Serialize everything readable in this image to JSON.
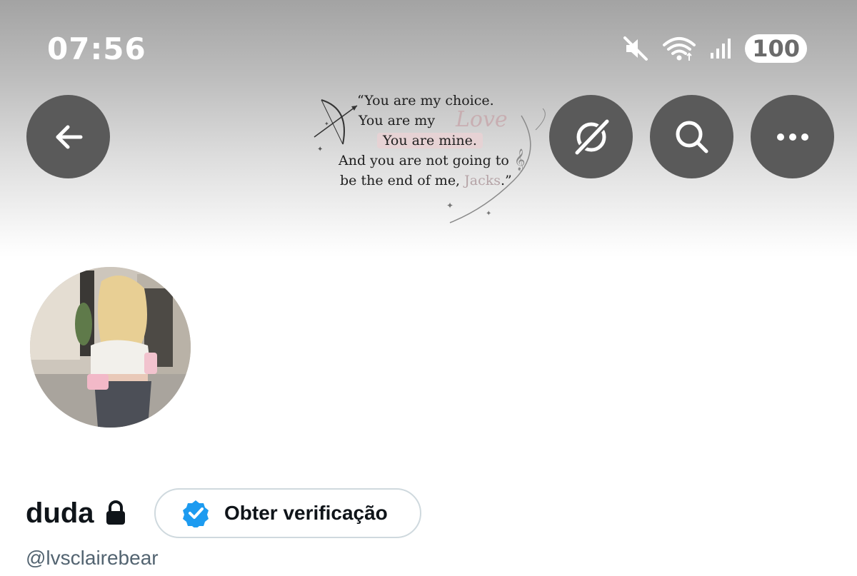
{
  "status_bar": {
    "time": "07:56",
    "battery": "100",
    "icons": [
      "mute-icon",
      "wifi-icon",
      "signal-icon",
      "battery-icon"
    ]
  },
  "header": {
    "banner_quote": {
      "line1": "“You are my choice.",
      "line2": "You are my",
      "line2_script": "Love",
      "line3": "You are mine.",
      "line4": "And you are not going to",
      "line5": "be the end of me,",
      "line5_name": "Jacks",
      "line5_end": ".”"
    },
    "buttons": [
      "back-arrow-icon",
      "explore-off-icon",
      "search-icon",
      "more-icon"
    ]
  },
  "profile": {
    "display_name": "duda",
    "handle": "@lvsclairebear",
    "verify_label": "Obter verificação",
    "protected": true
  },
  "colors": {
    "button_bg": "#5a5a5a",
    "verify_blue": "#1d9bf0",
    "text_primary": "#0f1419",
    "text_secondary": "#536471",
    "border": "#cfd9de"
  }
}
